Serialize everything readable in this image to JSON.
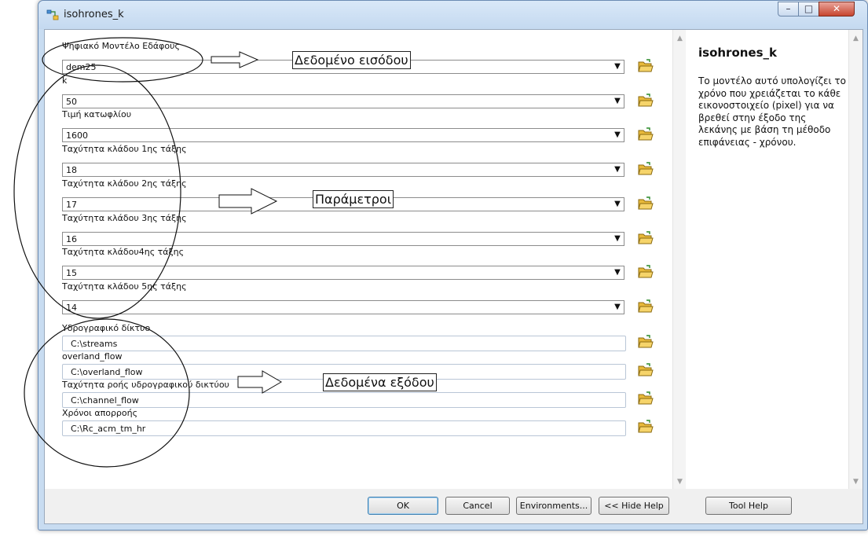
{
  "window": {
    "title": "isohrones_k",
    "controls": {
      "minimize": "–",
      "maximize": "□",
      "close": "✕"
    }
  },
  "parameters": [
    {
      "label": "Ψηφιακό Μοντέλο Εδάφους",
      "value": "dem25",
      "kind": "combo"
    },
    {
      "label": "k",
      "value": "50",
      "kind": "combo"
    },
    {
      "label": "Τιμή κατωφλίου",
      "value": "1600",
      "kind": "combo"
    },
    {
      "label": "Ταχύτητα κλάδου 1ης τάξης",
      "value": "18",
      "kind": "combo"
    },
    {
      "label": "Ταχύτητα κλάδου 2ης τάξης",
      "value": "17",
      "kind": "combo"
    },
    {
      "label": "Ταχύτητα κλάδου 3ης τάξης",
      "value": "16",
      "kind": "combo"
    },
    {
      "label": "Ταχύτητα κλάδου4ης τάξης",
      "value": "15",
      "kind": "combo"
    },
    {
      "label": "Ταχύτητα κλάδου 5ης τάξης",
      "value": "14",
      "kind": "combo"
    },
    {
      "label": "Υδρογραφικό δίκτυο",
      "value": "C:\\streams",
      "kind": "text"
    },
    {
      "label": "overland_flow",
      "value": "C:\\overland_flow",
      "kind": "text"
    },
    {
      "label": "Ταχύτητα ροής υδρογραφικού δικτύου",
      "value": "C:\\channel_flow",
      "kind": "text"
    },
    {
      "label": "Χρόνοι απορροής",
      "value": "C:\\Rc_acm_tm_hr",
      "kind": "text"
    }
  ],
  "help": {
    "title": "isohrones_k",
    "text": "Το μοντέλο αυτό υπολογίζει το χρόνο που χρειάζεται το κάθε εικονοστοιχείο (pixel) για να βρεθεί στην έξοδο της λεκάνης με βάση τη μέθοδο επιφάνειας - χρόνου."
  },
  "buttons": {
    "ok": "OK",
    "cancel": "Cancel",
    "environments": "Environments...",
    "hide_help": "<< Hide Help",
    "tool_help": "Tool Help"
  },
  "annotations": {
    "input": "Δεδομένο εισόδου",
    "parameters": "Παράμετροι",
    "output": "Δεδομένα εξόδου"
  },
  "icons": {
    "app": "model-icon",
    "browse": "folder-open-icon",
    "dropdown": "chevron-down-icon"
  },
  "colors": {
    "title_bar": "#c8dcf1",
    "close_button": "#c7452f",
    "folder": "#e8b93a",
    "ok_border": "#3c7fb1"
  }
}
